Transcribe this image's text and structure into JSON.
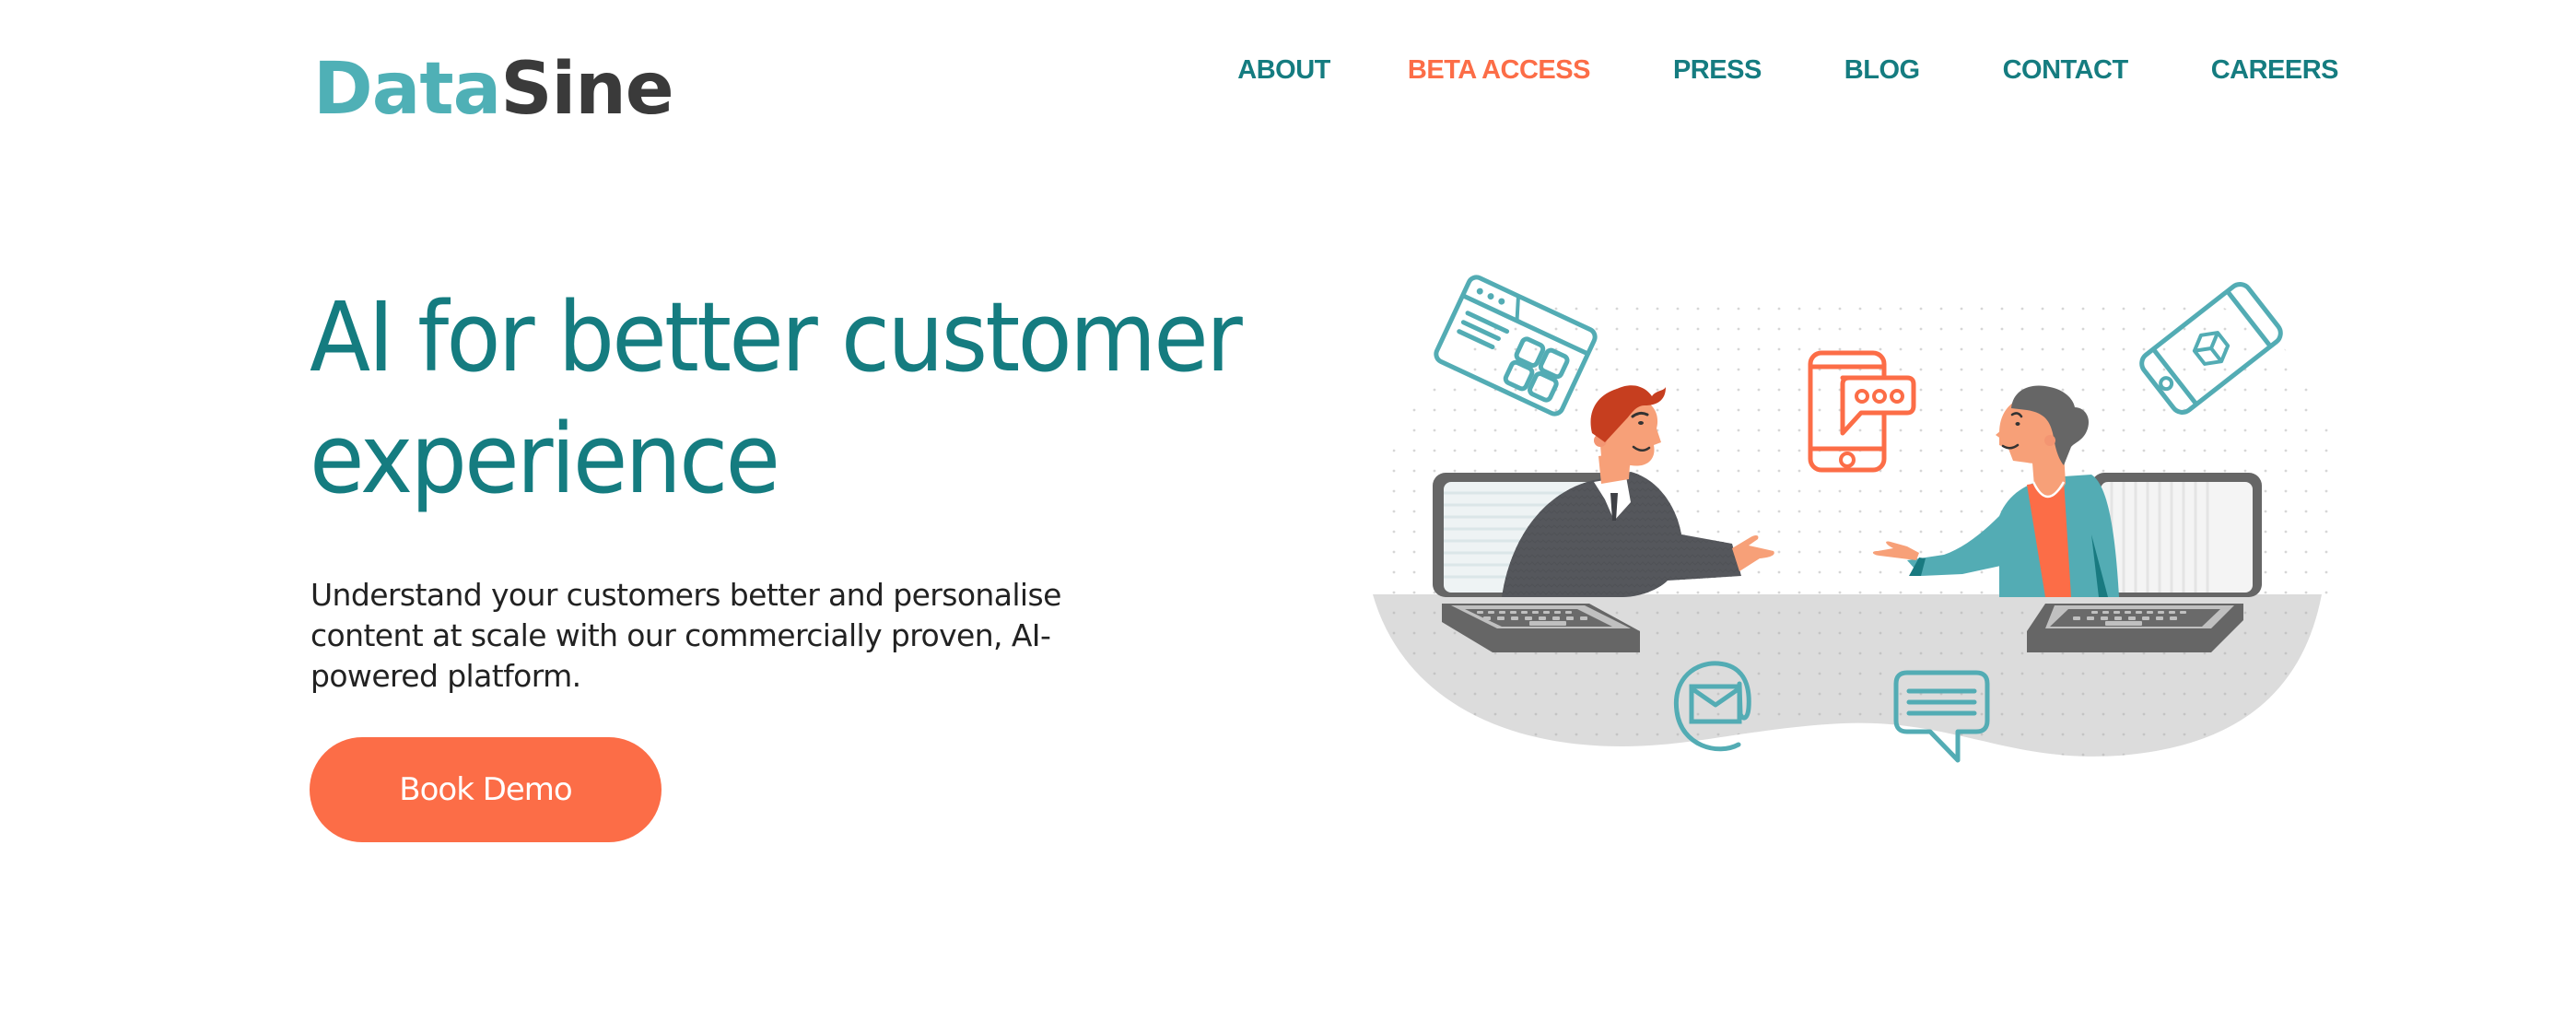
{
  "brand": {
    "logo_part_a": "Data",
    "logo_part_b": "Sine",
    "primary_color": "#157c80",
    "logo_teal": "#4fb0b6",
    "logo_dark": "#3a3a3a",
    "accent_color": "#fc6d47"
  },
  "nav": {
    "items": [
      {
        "label": "ABOUT",
        "active": false
      },
      {
        "label": "BETA ACCESS",
        "active": true
      },
      {
        "label": "PRESS",
        "active": false
      },
      {
        "label": "BLOG",
        "active": false
      },
      {
        "label": "CONTACT",
        "active": false
      },
      {
        "label": "CAREERS",
        "active": false
      }
    ]
  },
  "hero": {
    "title_line1": "AI for better customer",
    "title_line2": "experience",
    "subtitle": "Understand your customers better and personalise content at scale with our commercially proven, AI-powered platform.",
    "cta_label": "Book Demo"
  },
  "illustration": {
    "description": "Two people reaching out of laptops towards each other",
    "icons": [
      "web-app-icon",
      "mobile-chat-icon",
      "mobile-3d-cube-icon",
      "email-at-icon",
      "chat-bubble-icon"
    ]
  }
}
